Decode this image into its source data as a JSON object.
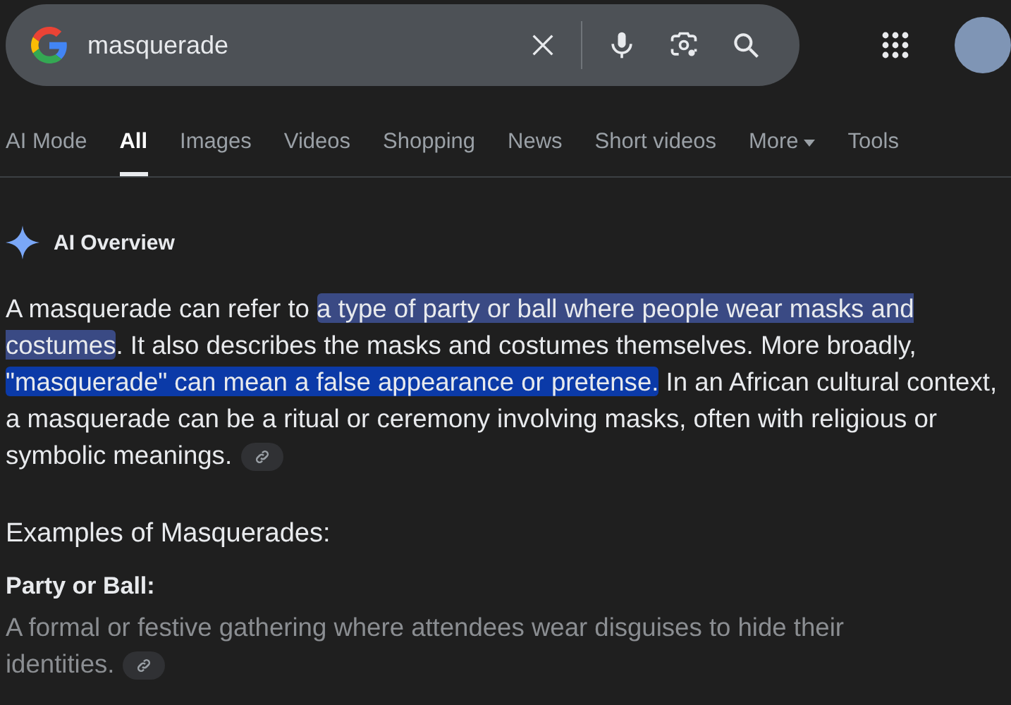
{
  "search": {
    "value": "masquerade"
  },
  "tabs": [
    {
      "label": "AI Mode",
      "selected": false
    },
    {
      "label": "All",
      "selected": true
    },
    {
      "label": "Images",
      "selected": false
    },
    {
      "label": "Videos",
      "selected": false
    },
    {
      "label": "Shopping",
      "selected": false
    },
    {
      "label": "News",
      "selected": false
    },
    {
      "label": "Short videos",
      "selected": false
    },
    {
      "label": "More",
      "selected": false,
      "kind": "menu"
    },
    {
      "label": "Tools",
      "selected": false
    }
  ],
  "overview": {
    "title": "AI Overview",
    "paragraph": [
      {
        "kind": "plain",
        "text": "A masquerade can refer to "
      },
      {
        "kind": "soft_highlight",
        "text": "a type of party or ball where people wear masks and costumes"
      },
      {
        "kind": "plain",
        "text": ". It also describes the masks and costumes themselves. More broadly, "
      },
      {
        "kind": "strong_highlight",
        "text": "\"masquerade\" can mean a false appearance or pretense."
      },
      {
        "kind": "plain",
        "text": " In an African cultural context, a masquerade can be a ritual or ceremony involving masks, often with religious or symbolic meanings."
      }
    ],
    "section_heading": "Examples of Masquerades:",
    "subheading": "Party or Ball:",
    "description": "A formal or festive gathering where attendees wear disguises to hide their identities."
  }
}
